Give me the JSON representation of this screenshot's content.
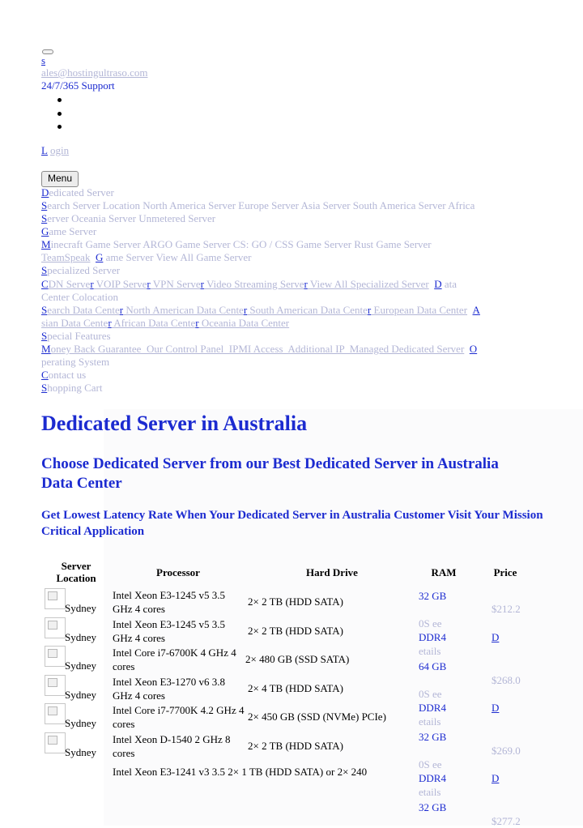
{
  "topbar": {
    "sales_letter": "s",
    "email": "ales@hostingultraso.com",
    "support": "24/7/365 Support",
    "login_letter": "L",
    "login_rest": "ogin",
    "menu_label": "Menu"
  },
  "nav": {
    "dedicated": {
      "letter": "D",
      "rest": "edicated Server"
    },
    "search_line": "earch Server Location North America Server Europe Server Asia Server South America Server Africa",
    "search_letter": "S",
    "search_line2_letter": "S",
    "search_line2": "erver Oceania Server Unmetered Server",
    "game": {
      "letter": "G",
      "rest": "ame Server"
    },
    "minecraft_letter": "M",
    "minecraft_line": "inecraft Game Server ARGO Game Server CS: GO / CSS Game Server Rust Game Server",
    "teamspeak": "TeamSpeak",
    "teamspeak_letter": "G",
    "teamspeak_rest": "ame Server View All Game Server",
    "specialized": {
      "letter": "S",
      "rest": "pecialized Server"
    },
    "cdn_letter": "C",
    "cdn_parts": [
      "DN Serve",
      "r",
      " VOIP Serve",
      "r",
      " VPN Serve",
      "r",
      " Video Streaming Serve",
      "r",
      " View All Specialized Server",
      "D",
      "ata"
    ],
    "colocation": "Center Colocation",
    "sdc_letter": "S",
    "sdc_parts": [
      "earch Data Cente",
      "r",
      " North American Data Cente",
      "r",
      " South American Data Cente",
      "r",
      " European Data Center",
      "A"
    ],
    "asian_parts": [
      "sian Data Cente",
      "r",
      " African Data Cente",
      "r",
      " Oceania Data Center"
    ],
    "special": {
      "letter": "S",
      "rest": "pecial Features"
    },
    "money_letter": "M",
    "money_line": "oney Back Guarantee  Our Control Panel  IPMI Access  Additional IP  Managed Dedicated Server",
    "money_o": "O",
    "operating": "perating System",
    "contact": {
      "letter": "C",
      "rest": "ontact us"
    },
    "cart": {
      "letter": "S",
      "rest": "hopping Cart"
    }
  },
  "hero": {
    "title": "Dedicated Server in Australia",
    "subtitle": "Choose Dedicated Server from our Best Dedicated Server in Australia Data Center",
    "tagline": "Get Lowest Latency Rate When Your Dedicated Server in Australia Customer Visit Your Mission Critical Application"
  },
  "table": {
    "headers": {
      "location": "Server Location",
      "processor": "Processor",
      "drive": "Hard Drive",
      "ram": "RAM",
      "price": "Price"
    },
    "rows": [
      {
        "location": "Sydney",
        "processor": "Intel Xeon E3-1245 v5 3.5 GHz 4 cores",
        "drive": "2× 2 TB (HDD SATA)"
      },
      {
        "location": "Sydney",
        "processor": "Intel Xeon E3-1245 v5 3.5 GHz 4 cores",
        "drive": "2× 2 TB (HDD SATA)"
      },
      {
        "location": "Sydney",
        "processor": "Intel Core i7-6700K 4 GHz 4 cores",
        "drive": "2× 480 GB (SSD SATA)"
      },
      {
        "location": "Sydney",
        "processor": "Intel Xeon E3-1270 v6 3.8 GHz 4 cores",
        "drive": "2× 4 TB (HDD SATA)"
      },
      {
        "location": "Sydney",
        "processor": "Intel Core i7-7700K 4.2 GHz 4 cores",
        "drive": "2× 450 GB (SSD (NVMe) PCIe)"
      },
      {
        "location": "Sydney",
        "processor": "Intel Xeon D-1540 2 GHz 8 cores",
        "drive": "2× 2 TB (HDD SATA)"
      }
    ],
    "last_row_text": "Intel Xeon E3-1241 v3 3.5 2× 1 TB (HDD SATA) or 2× 240",
    "ram_column": [
      "32 GB",
      "0S ee",
      "DDR4",
      "etails",
      "64 GB",
      "0S ee",
      "DDR4",
      "etails",
      "32 GB",
      "0S ee",
      "DDR4",
      "etails",
      "32 GB"
    ],
    "price_column": [
      "$212.2",
      "D",
      "$268.0",
      "D",
      "$269.0",
      "D",
      "$277.2"
    ]
  }
}
